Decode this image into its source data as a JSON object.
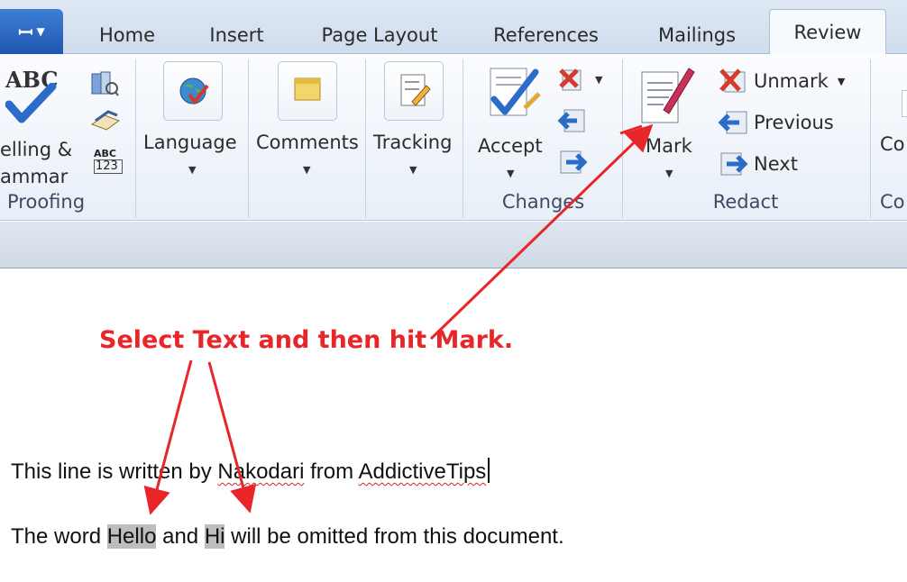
{
  "tabs": {
    "file_icon": "▼",
    "home": "Home",
    "insert": "Insert",
    "page_layout": "Page Layout",
    "references": "References",
    "mailings": "Mailings",
    "review": "Review"
  },
  "ribbon": {
    "proofing": {
      "abc": "ABC",
      "spelling_label_1": "elling &",
      "spelling_label_2": "ammar",
      "abc123_top": "ABC",
      "abc123_bottom": "123",
      "group_label": "Proofing"
    },
    "language": {
      "label": "Language"
    },
    "comments": {
      "label": "Comments"
    },
    "tracking": {
      "label": "Tracking"
    },
    "changes": {
      "accept_label": "Accept",
      "group_label": "Changes"
    },
    "redact": {
      "mark_label": "Mark",
      "unmark_label": "Unmark",
      "previous_label": "Previous",
      "next_label": "Next",
      "group_label": "Redact"
    },
    "cut_off": {
      "label": "Co",
      "group_label": "Co"
    }
  },
  "document": {
    "annotation": "Select Text and then hit Mark.",
    "line1": {
      "part1": "This line is written by ",
      "word_nakodari": "Nakodari",
      "part2": " from ",
      "word_addictivetips": "AddictiveTips"
    },
    "line2": {
      "part1": "The word ",
      "hl1": "Hello",
      "part2": " and ",
      "hl2": "Hi",
      "part3": " will be omitted from this document."
    }
  },
  "colors": {
    "annotation_red": "#e8262a",
    "accent_blue": "#1f56b0",
    "highlight_gray": "#bdbdbd"
  }
}
